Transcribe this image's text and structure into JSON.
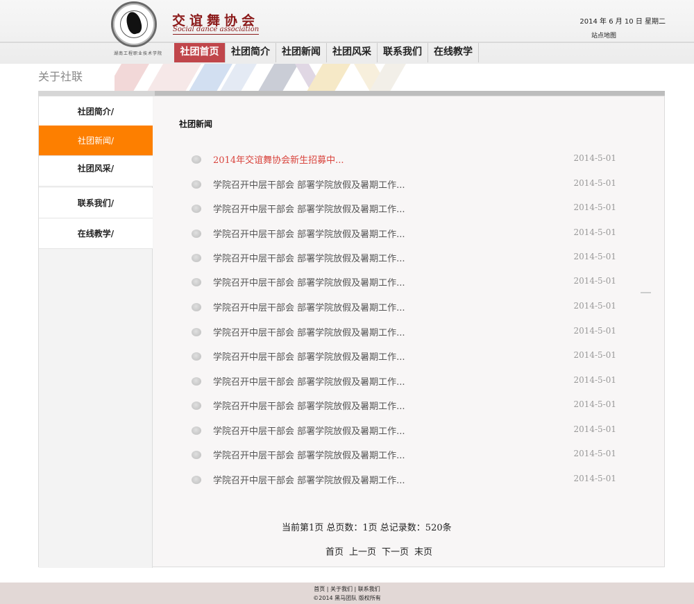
{
  "header": {
    "logo_cn": "交谊舞协会",
    "logo_en": "Social dance association",
    "school": "湖南工程职业技术学院",
    "date": "2014 年 6 月 10 日  星期二",
    "sitemap": "站点地图"
  },
  "nav": [
    {
      "label": "社团首页"
    },
    {
      "label": "社团简介"
    },
    {
      "label": "社团新闻"
    },
    {
      "label": "社团风采"
    },
    {
      "label": "联系我们"
    },
    {
      "label": "在线教学"
    }
  ],
  "banner": {
    "title": "关于社联"
  },
  "sidebar": [
    {
      "label": "社团简介/"
    },
    {
      "label": "社团新闻/"
    },
    {
      "label": "社团风采/"
    },
    {
      "label": "联系我们/"
    },
    {
      "label": "在线教学/"
    }
  ],
  "section_title": "社团新闻",
  "news": [
    {
      "title": "2014年交谊舞协会新生招募中...",
      "date": "2014-5-01"
    },
    {
      "title": "学院召开中层干部会 部署学院放假及暑期工作...",
      "date": "2014-5-01"
    },
    {
      "title": "学院召开中层干部会 部署学院放假及暑期工作...",
      "date": "2014-5-01"
    },
    {
      "title": "学院召开中层干部会 部署学院放假及暑期工作...",
      "date": "2014-5-01"
    },
    {
      "title": "学院召开中层干部会 部署学院放假及暑期工作...",
      "date": "2014-5-01"
    },
    {
      "title": "学院召开中层干部会 部署学院放假及暑期工作...",
      "date": "2014-5-01"
    },
    {
      "title": "学院召开中层干部会 部署学院放假及暑期工作...",
      "date": "2014-5-01"
    },
    {
      "title": "学院召开中层干部会 部署学院放假及暑期工作...",
      "date": "2014-5-01"
    },
    {
      "title": "学院召开中层干部会 部署学院放假及暑期工作...",
      "date": "2014-5-01"
    },
    {
      "title": "学院召开中层干部会 部署学院放假及暑期工作...",
      "date": "2014-5-01"
    },
    {
      "title": "学院召开中层干部会 部署学院放假及暑期工作...",
      "date": "2014-5-01"
    },
    {
      "title": "学院召开中层干部会 部署学院放假及暑期工作...",
      "date": "2014-5-01"
    },
    {
      "title": "学院召开中层干部会 部署学院放假及暑期工作...",
      "date": "2014-5-01"
    },
    {
      "title": "学院召开中层干部会 部署学院放假及暑期工作...",
      "date": "2014-5-01"
    }
  ],
  "paging": {
    "info": "当前第1页  总页数：1页  总记录数：520条",
    "first": "首页",
    "prev": "上一页",
    "next": "下一页",
    "last": "末页"
  },
  "footer": {
    "link1": "首页",
    "link2": "关于我们",
    "link3": "联系我们",
    "copyright": "©2014  黑马团队  版权所有"
  },
  "colors": {
    "nav_active": "#c0464b",
    "sidebar_active": "#fd7f00",
    "highlight_news": "#d9443d",
    "footer_bg": "#e2d8d6"
  }
}
